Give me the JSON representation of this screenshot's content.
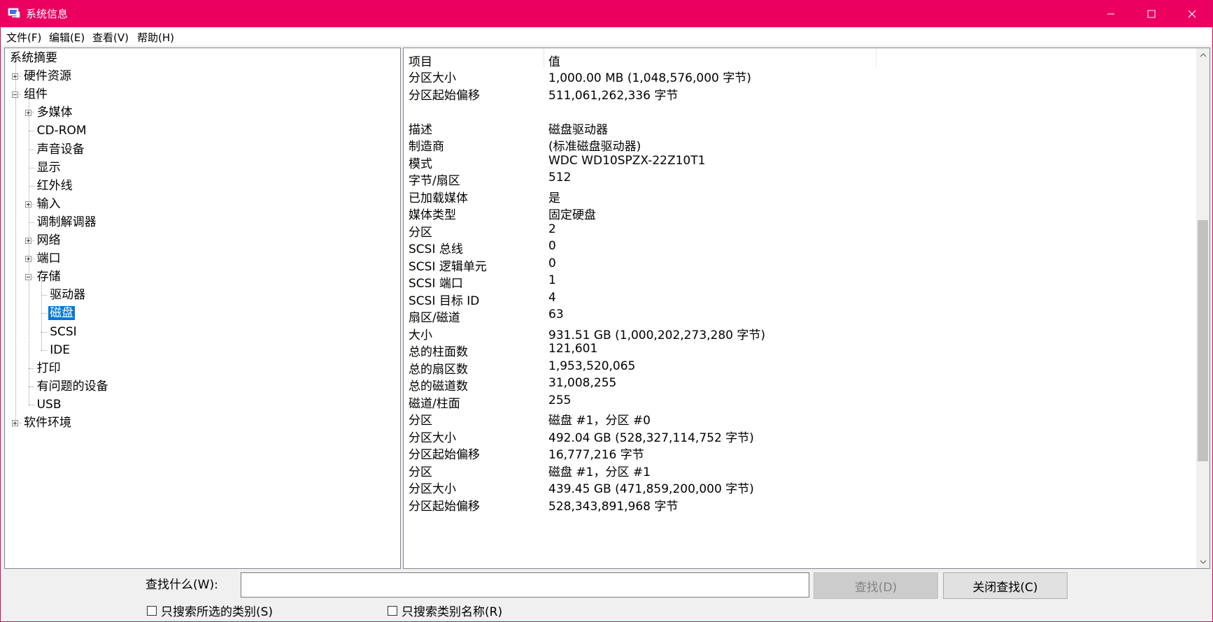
{
  "window": {
    "title": "系统信息"
  },
  "menu": [
    "文件(F)",
    "编辑(E)",
    "查看(V)",
    "帮助(H)"
  ],
  "tree": [
    {
      "label": "系统摘要",
      "depth": 0,
      "expander": "none"
    },
    {
      "label": "硬件资源",
      "depth": 1,
      "expander": "plus"
    },
    {
      "label": "组件",
      "depth": 1,
      "expander": "minus"
    },
    {
      "label": "多媒体",
      "depth": 2,
      "expander": "plus"
    },
    {
      "label": "CD-ROM",
      "depth": 2,
      "expander": "none"
    },
    {
      "label": "声音设备",
      "depth": 2,
      "expander": "none"
    },
    {
      "label": "显示",
      "depth": 2,
      "expander": "none"
    },
    {
      "label": "红外线",
      "depth": 2,
      "expander": "none"
    },
    {
      "label": "输入",
      "depth": 2,
      "expander": "plus"
    },
    {
      "label": "调制解调器",
      "depth": 2,
      "expander": "none"
    },
    {
      "label": "网络",
      "depth": 2,
      "expander": "plus"
    },
    {
      "label": "端口",
      "depth": 2,
      "expander": "plus"
    },
    {
      "label": "存储",
      "depth": 2,
      "expander": "minus"
    },
    {
      "label": "驱动器",
      "depth": 3,
      "expander": "none"
    },
    {
      "label": "磁盘",
      "depth": 3,
      "expander": "none",
      "selected": true
    },
    {
      "label": "SCSI",
      "depth": 3,
      "expander": "none"
    },
    {
      "label": "IDE",
      "depth": 3,
      "expander": "none"
    },
    {
      "label": "打印",
      "depth": 2,
      "expander": "none"
    },
    {
      "label": "有问题的设备",
      "depth": 2,
      "expander": "none"
    },
    {
      "label": "USB",
      "depth": 2,
      "expander": "none"
    },
    {
      "label": "软件环境",
      "depth": 1,
      "expander": "plus"
    }
  ],
  "list": {
    "headers": [
      "项目",
      "值"
    ],
    "rows": [
      [
        "分区大小",
        "1,000.00 MB (1,048,576,000 字节)"
      ],
      [
        "分区起始偏移",
        "511,061,262,336 字节"
      ],
      [
        "",
        ""
      ],
      [
        "描述",
        "磁盘驱动器"
      ],
      [
        "制造商",
        "(标准磁盘驱动器)"
      ],
      [
        "模式",
        "WDC WD10SPZX-22Z10T1"
      ],
      [
        "字节/扇区",
        "512"
      ],
      [
        "已加载媒体",
        "是"
      ],
      [
        "媒体类型",
        "固定硬盘"
      ],
      [
        "分区",
        "2"
      ],
      [
        "SCSI 总线",
        "0"
      ],
      [
        "SCSI 逻辑单元",
        "0"
      ],
      [
        "SCSI 端口",
        "1"
      ],
      [
        "SCSI 目标 ID",
        "4"
      ],
      [
        "扇区/磁道",
        "63"
      ],
      [
        "大小",
        "931.51 GB (1,000,202,273,280 字节)"
      ],
      [
        "总的柱面数",
        "121,601"
      ],
      [
        "总的扇区数",
        "1,953,520,065"
      ],
      [
        "总的磁道数",
        "31,008,255"
      ],
      [
        "磁道/柱面",
        "255"
      ],
      [
        "分区",
        "磁盘 #1，分区 #0"
      ],
      [
        "分区大小",
        "492.04 GB (528,327,114,752 字节)"
      ],
      [
        "分区起始偏移",
        "16,777,216 字节"
      ],
      [
        "分区",
        "磁盘 #1，分区 #1"
      ],
      [
        "分区大小",
        "439.45 GB (471,859,200,000 字节)"
      ],
      [
        "分区起始偏移",
        "528,343,891,968 字节"
      ]
    ]
  },
  "find": {
    "label": "查找什么(W):",
    "value": "",
    "find_button": "查找(D)",
    "close_button": "关闭查找(C)",
    "check_selected_category": "只搜索所选的类别(S)",
    "check_category_names": "只搜索类别名称(R)"
  },
  "scrollbar": {
    "position_fraction": 0.63
  },
  "colors": {
    "titlebar": "#eb0060",
    "selection": "#0078d7"
  }
}
